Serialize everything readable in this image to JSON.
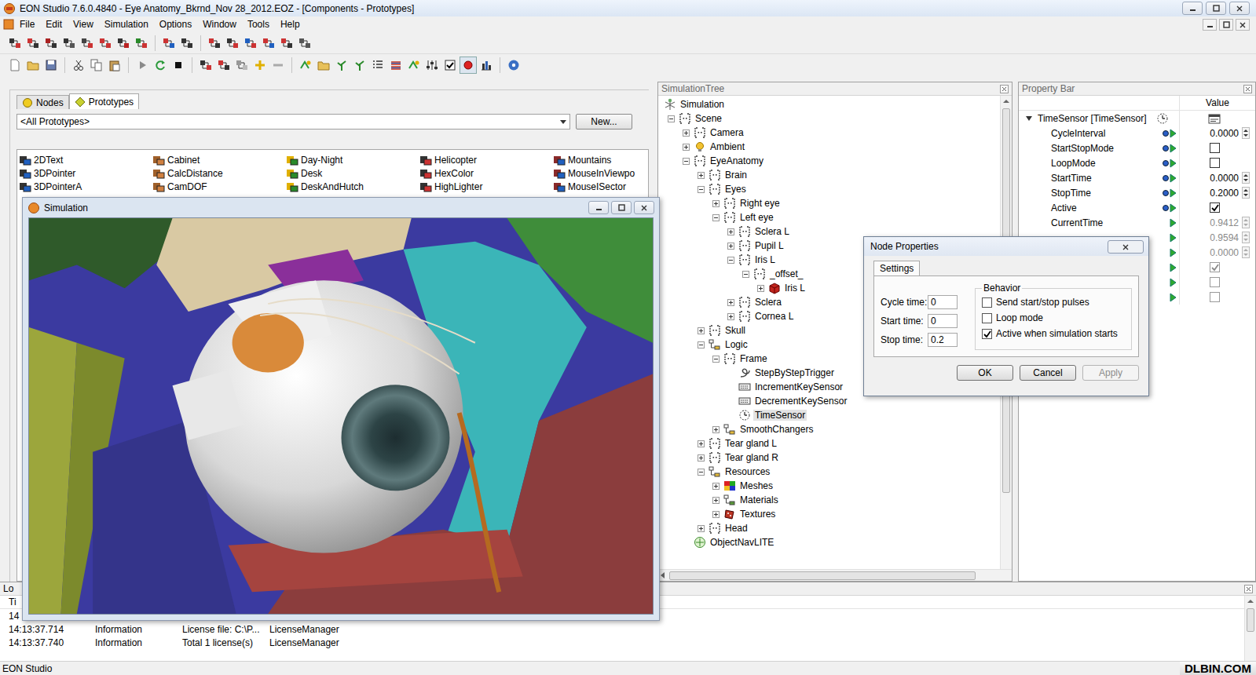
{
  "window": {
    "title": "EON Studio 7.6.0.4840 - Eye Anatomy_Bkrnd_Nov 28_2012.EOZ - [Components - Prototypes]"
  },
  "menu": [
    "File",
    "Edit",
    "View",
    "Simulation",
    "Options",
    "Window",
    "Tools",
    "Help"
  ],
  "components": {
    "tabs": [
      {
        "label": "Nodes",
        "selected": false
      },
      {
        "label": "Prototypes",
        "selected": true
      }
    ],
    "filter": "<All Prototypes>",
    "new_button": "New...",
    "prototypes": [
      "2DText",
      "Cabinet",
      "Day-Night",
      "Helicopter",
      "Mountains",
      "3DPointer",
      "CalcDistance",
      "Desk",
      "HexColor",
      "MouseInViewpo",
      "3DPointerA",
      "CamDOF",
      "DeskAndHutch",
      "HighLighter",
      "MouseISector"
    ]
  },
  "simulation_window": {
    "title": "Simulation"
  },
  "tree": {
    "title": "SimulationTree",
    "nodes": [
      {
        "label": "Simulation",
        "kind": "sim",
        "selected": false,
        "children": [
          {
            "label": "Scene",
            "kind": "frame",
            "expanded": true,
            "selected": false,
            "children": [
              {
                "label": "Camera",
                "kind": "frame",
                "expanded": false,
                "selected": false
              },
              {
                "label": "Ambient",
                "kind": "light",
                "expanded": false,
                "selected": false
              },
              {
                "label": "EyeAnatomy",
                "kind": "frame",
                "expanded": true,
                "selected": false,
                "children": [
                  {
                    "label": "Brain",
                    "kind": "frame",
                    "expanded": false,
                    "selected": false
                  },
                  {
                    "label": "Eyes",
                    "kind": "frame",
                    "expanded": true,
                    "selected": false,
                    "children": [
                      {
                        "label": "Right eye",
                        "kind": "frame",
                        "expanded": false,
                        "selected": false
                      },
                      {
                        "label": "Left eye",
                        "kind": "frame",
                        "expanded": true,
                        "selected": false,
                        "children": [
                          {
                            "label": "Sclera L",
                            "kind": "frame",
                            "expanded": false,
                            "selected": false
                          },
                          {
                            "label": "Pupil L",
                            "kind": "frame",
                            "expanded": false,
                            "selected": false
                          },
                          {
                            "label": "Iris L",
                            "kind": "frame",
                            "expanded": true,
                            "selected": false,
                            "children": [
                              {
                                "label": "_offset_",
                                "kind": "frame",
                                "expanded": true,
                                "selected": false,
                                "children": [
                                  {
                                    "label": "Iris L",
                                    "kind": "shape",
                                    "expanded": false,
                                    "selected": false
                                  }
                                ]
                              }
                            ]
                          },
                          {
                            "label": "Sclera",
                            "kind": "frame",
                            "expanded": false,
                            "selected": false
                          },
                          {
                            "label": "Cornea L",
                            "kind": "frame",
                            "expanded": false,
                            "selected": false
                          }
                        ]
                      }
                    ]
                  },
                  {
                    "label": "Skull",
                    "kind": "frame",
                    "expanded": false,
                    "selected": false
                  },
                  {
                    "label": "Logic",
                    "kind": "folder",
                    "expanded": true,
                    "selected": false,
                    "children": [
                      {
                        "label": "Frame",
                        "kind": "frame",
                        "expanded": true,
                        "selected": false,
                        "children": [
                          {
                            "label": "StepByStepTrigger",
                            "kind": "trigger",
                            "selected": false
                          },
                          {
                            "label": "IncrementKeySensor",
                            "kind": "keysensor",
                            "selected": false
                          },
                          {
                            "label": "DecrementKeySensor",
                            "kind": "keysensor",
                            "selected": false
                          },
                          {
                            "label": "TimeSensor",
                            "kind": "timesensor",
                            "selected": true
                          }
                        ]
                      },
                      {
                        "label": "SmoothChangers",
                        "kind": "folder",
                        "expanded": false,
                        "selected": false
                      }
                    ]
                  },
                  {
                    "label": "Tear gland L",
                    "kind": "frame",
                    "expanded": false,
                    "selected": false
                  },
                  {
                    "label": "Tear gland R",
                    "kind": "frame",
                    "expanded": false,
                    "selected": false
                  },
                  {
                    "label": "Resources",
                    "kind": "folder",
                    "expanded": true,
                    "selected": false,
                    "children": [
                      {
                        "label": "Meshes",
                        "kind": "meshes",
                        "expanded": false,
                        "selected": false
                      },
                      {
                        "label": "Materials",
                        "kind": "materials",
                        "expanded": false,
                        "selected": false
                      },
                      {
                        "label": "Textures",
                        "kind": "textures",
                        "expanded": false,
                        "selected": false
                      }
                    ]
                  },
                  {
                    "label": "Head",
                    "kind": "frame",
                    "expanded": false,
                    "selected": false
                  }
                ]
              },
              {
                "label": "ObjectNavLITE",
                "kind": "nav",
                "selected": false
              }
            ]
          }
        ]
      }
    ]
  },
  "property_bar": {
    "title": "Property Bar",
    "value_header": "Value",
    "group": {
      "label": "TimeSensor [TimeSensor]",
      "expanded": true
    },
    "rows": [
      {
        "name": "CycleInterval",
        "ports": "in-out",
        "kind": "number",
        "value": "0.0000",
        "disabled": false
      },
      {
        "name": "StartStopMode",
        "ports": "in-out",
        "kind": "checkbox",
        "checked": false,
        "disabled": false
      },
      {
        "name": "LoopMode",
        "ports": "in-out",
        "kind": "checkbox",
        "checked": false,
        "disabled": false
      },
      {
        "name": "StartTime",
        "ports": "in-out",
        "kind": "number",
        "value": "0.0000",
        "disabled": false
      },
      {
        "name": "StopTime",
        "ports": "in-out",
        "kind": "number",
        "value": "0.2000",
        "disabled": false
      },
      {
        "name": "Active",
        "ports": "in-out",
        "kind": "checkbox",
        "checked": true,
        "disabled": false
      },
      {
        "name": "CurrentTime",
        "ports": "out",
        "kind": "number",
        "value": "0.9412",
        "disabled": true
      },
      {
        "name": "",
        "ports": "out",
        "kind": "number",
        "value": "0.9594",
        "disabled": true
      },
      {
        "name": "",
        "ports": "out",
        "kind": "number",
        "value": "0.0000",
        "disabled": true
      },
      {
        "name": "",
        "ports": "out",
        "kind": "checkbox",
        "checked": true,
        "disabled": true
      },
      {
        "name": "",
        "ports": "out",
        "kind": "checkbox",
        "checked": false,
        "disabled": true
      },
      {
        "name": "",
        "ports": "out",
        "kind": "checkbox",
        "checked": false,
        "disabled": true
      }
    ]
  },
  "dialog": {
    "title": "Node Properties",
    "tab": "Settings",
    "fields": [
      {
        "label": "Cycle time:",
        "value": "0"
      },
      {
        "label": "Start time:",
        "value": "0"
      },
      {
        "label": "Stop time:",
        "value": "0.2"
      }
    ],
    "group_label": "Behavior",
    "options": [
      {
        "label": "Send start/stop pulses",
        "checked": false
      },
      {
        "label": "Loop mode",
        "checked": false
      },
      {
        "label": "Active when simulation starts",
        "checked": true
      }
    ],
    "buttons": [
      {
        "label": "OK",
        "disabled": false
      },
      {
        "label": "Cancel",
        "disabled": false
      },
      {
        "label": "Apply",
        "disabled": true
      }
    ]
  },
  "log": {
    "title": "Lo",
    "columns": [
      "Ti"
    ],
    "rows": [
      [
        "14"
      ],
      [
        "14:13:37.714",
        "Information",
        "License file: C:\\P...",
        "LicenseManager"
      ],
      [
        "14:13:37.740",
        "Information",
        "Total 1 license(s)",
        "LicenseManager"
      ]
    ]
  },
  "status_bar": {
    "text": "EON Studio",
    "watermark": "DLBIN.COM"
  }
}
